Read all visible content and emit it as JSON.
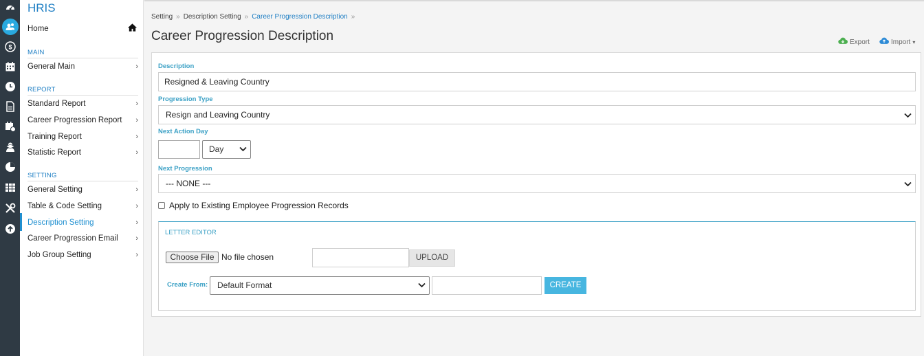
{
  "rail": {
    "icons": [
      "dashboard-icon",
      "users-icon",
      "payroll-icon",
      "calendar-icon",
      "clock-icon",
      "document-icon",
      "schedule-icon",
      "training-icon",
      "report-icon",
      "grid-icon",
      "tools-icon",
      "upload-icon"
    ]
  },
  "sidebar": {
    "brand": "HRIS",
    "home": "Home",
    "sections": {
      "main": "MAIN",
      "report": "REPORT",
      "setting": "SETTING"
    },
    "main_items": [
      "General Main"
    ],
    "report_items": [
      "Standard Report",
      "Career Progression Report",
      "Training Report",
      "Statistic Report"
    ],
    "setting_items": [
      "General Setting",
      "Table & Code Setting",
      "Description Setting",
      "Career Progression Email",
      "Job Group Setting"
    ],
    "chevron": "›"
  },
  "breadcrumb": {
    "items": [
      "Setting",
      "Description Setting",
      "Career Progression Description"
    ],
    "sep": "»"
  },
  "page": {
    "title": "Career Progression Description",
    "export": "Export",
    "import": "Import"
  },
  "form": {
    "description_label": "Description",
    "description_value": "Resigned & Leaving Country",
    "progression_type_label": "Progression Type",
    "progression_type_value": "Resign and Leaving Country",
    "next_action_label": "Next Action Day",
    "next_action_value": "",
    "next_action_unit": "Day",
    "next_progression_label": "Next Progression",
    "next_progression_value": "--- NONE ---",
    "apply_label": "Apply to Existing Employee Progression Records"
  },
  "letter": {
    "title": "LETTER EDITOR",
    "choose_file": "Choose File",
    "no_file": "No file chosen",
    "upload": "UPLOAD",
    "create_from_label": "Create From:",
    "create_from_value": "Default Format",
    "create": "CREATE"
  },
  "colors": {
    "accent": "#1f7fc4",
    "label": "#3aa0c5",
    "rail": "#2f3a44",
    "create_button": "#47b6e0",
    "export_icon": "#4caf50",
    "import_icon": "#2e8bd6"
  }
}
